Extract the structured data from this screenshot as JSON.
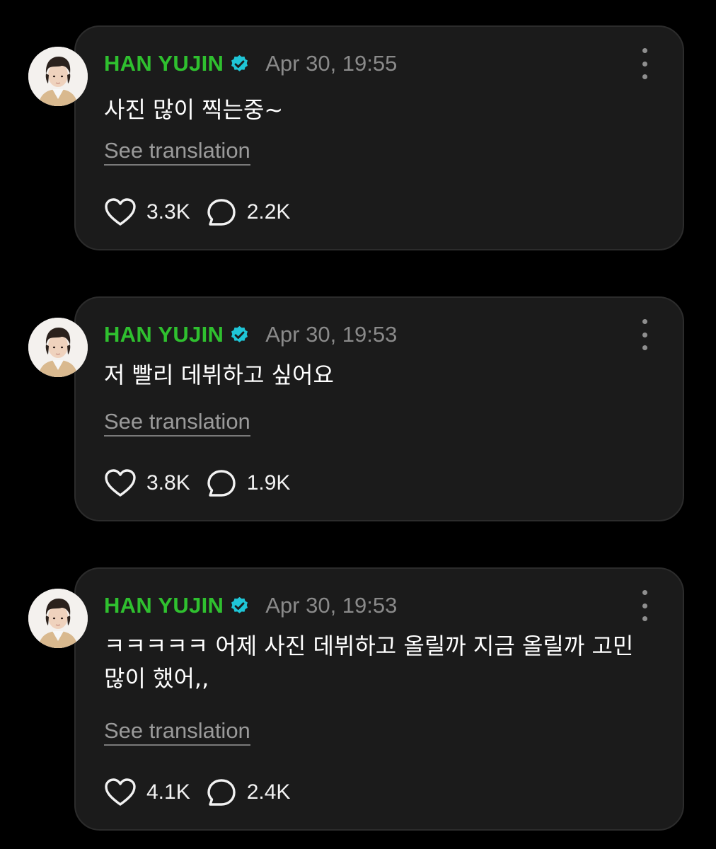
{
  "posts": [
    {
      "author": "HAN YUJIN",
      "timestamp": "Apr 30, 19:55",
      "text": "사진 많이 찍는중~",
      "translate_label": "See translation",
      "likes": "3.3K",
      "comments": "2.2K"
    },
    {
      "author": "HAN YUJIN",
      "timestamp": "Apr 30, 19:53",
      "text": "저 빨리 데뷔하고 싶어요",
      "translate_label": "See translation",
      "likes": "3.8K",
      "comments": "1.9K"
    },
    {
      "author": "HAN YUJIN",
      "timestamp": "Apr 30, 19:53",
      "text": "ㅋㅋㅋㅋㅋ 어제 사진 데뷔하고 올릴까 지금 올릴까 고민 많이 했어,,",
      "translate_label": "See translation",
      "likes": "4.1K",
      "comments": "2.4K"
    }
  ],
  "icons": {
    "verified": "verified-badge-icon",
    "more": "more-vertical-icon",
    "like": "heart-icon",
    "comment": "comment-bubble-icon"
  },
  "colors": {
    "background": "#000000",
    "card": "#1b1b1b",
    "name": "#2fc02f",
    "verified": "#1fc5d6",
    "timestamp": "#8a8a8a"
  }
}
